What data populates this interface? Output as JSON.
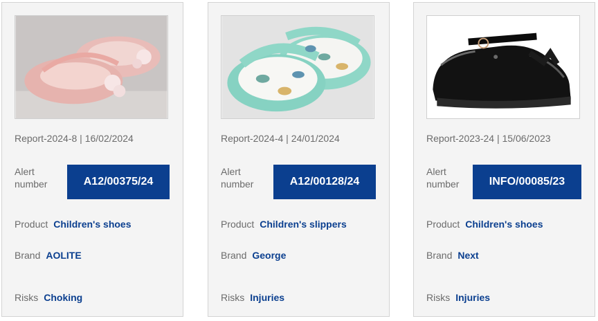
{
  "colors": {
    "accent": "#0b3f8f",
    "card_bg": "#f4f4f4",
    "muted_text": "#6b6b6b"
  },
  "labels": {
    "alert_number": "Alert number",
    "product": "Product",
    "brand": "Brand",
    "risks": "Risks"
  },
  "cards": [
    {
      "image": "pink-toddler-shoes",
      "report": "Report-2024-8 | 16/02/2024",
      "alert_number": "A12/00375/24",
      "product": "Children's shoes",
      "brand": "AOLITE",
      "risks": "Choking"
    },
    {
      "image": "dinosaur-slippers",
      "report": "Report-2024-4 | 24/01/2024",
      "alert_number": "A12/00128/24",
      "product": "Children's slippers",
      "brand": "George",
      "risks": "Injuries"
    },
    {
      "image": "black-patent-shoe",
      "report": "Report-2023-24 | 15/06/2023",
      "alert_number": "INFO/00085/23",
      "product": "Children's shoes",
      "brand": "Next",
      "risks": "Injuries"
    }
  ]
}
